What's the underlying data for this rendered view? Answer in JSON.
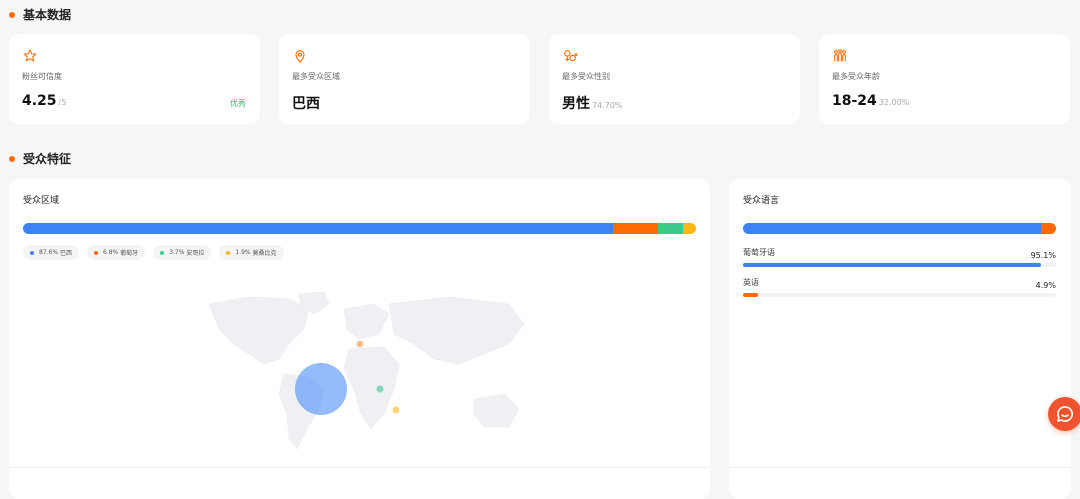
{
  "sections": {
    "basic": "基本数据",
    "audience": "受众特征"
  },
  "stats": [
    {
      "icon": "star-icon",
      "label": "粉丝可信度",
      "value": "4.25",
      "sub": "/5",
      "badge": "优秀"
    },
    {
      "icon": "location-pin-icon",
      "label": "最多受众区域",
      "value": "巴西",
      "sub": "",
      "badge": ""
    },
    {
      "icon": "gender-icon",
      "label": "最多受众性别",
      "value": "男性",
      "sub": "74.70%",
      "badge": ""
    },
    {
      "icon": "people-group-icon",
      "label": "最多受众年龄",
      "value": "18-24",
      "sub": "32.00%",
      "badge": ""
    }
  ],
  "region": {
    "title": "受众区域",
    "items": [
      {
        "pct": 87.6,
        "label": "87.6%",
        "name": "巴西",
        "color": "#3d83f7"
      },
      {
        "pct": 6.8,
        "label": "6.8%",
        "name": "葡萄牙",
        "color": "#ff6a00"
      },
      {
        "pct": 3.7,
        "label": "3.7%",
        "name": "安哥拉",
        "color": "#3cc98d"
      },
      {
        "pct": 1.9,
        "label": "1.9%",
        "name": "莫桑比克",
        "color": "#fbb515"
      }
    ]
  },
  "language": {
    "title": "受众语言",
    "items": [
      {
        "name": "葡萄牙语",
        "pct": 95.1,
        "label": "95.1%",
        "color": "#3d83f7"
      },
      {
        "name": "英语",
        "pct": 4.9,
        "label": "4.9%",
        "color": "#ff6a00"
      }
    ]
  },
  "colors": {
    "accent": "#ff6a00",
    "primary": "#3d83f7",
    "success": "#27c26c",
    "chat": "#f0532f"
  },
  "chat_button": {
    "icon": "chat-bubble-icon"
  }
}
